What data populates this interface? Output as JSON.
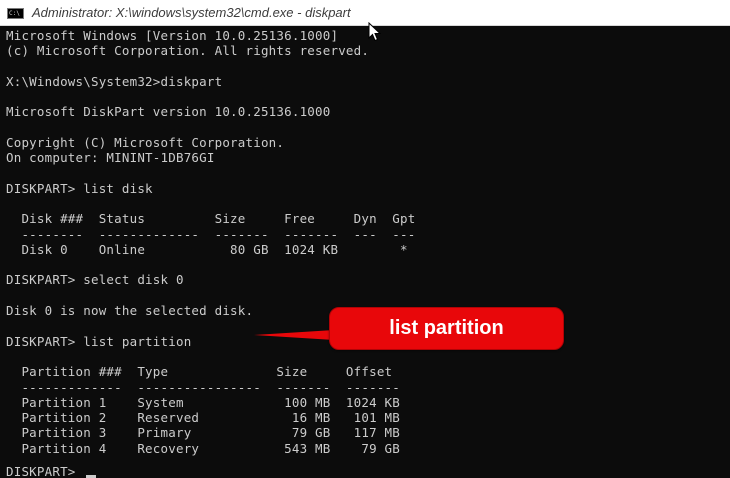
{
  "window": {
    "icon_text": "C:\\",
    "title": "Administrator: X:\\windows\\system32\\cmd.exe - diskpart"
  },
  "console": {
    "lines": [
      "Microsoft Windows [Version 10.0.25136.1000]",
      "(c) Microsoft Corporation. All rights reserved.",
      "",
      "X:\\Windows\\System32>diskpart",
      "",
      "Microsoft DiskPart version 10.0.25136.1000",
      "",
      "Copyright (C) Microsoft Corporation.",
      "On computer: MININT-1DB76GI",
      "",
      "DISKPART> list disk",
      "",
      "  Disk ###  Status         Size     Free     Dyn  Gpt",
      "  --------  -------------  -------  -------  ---  ---",
      "  Disk 0    Online           80 GB  1024 KB        *",
      "",
      "DISKPART> select disk 0",
      "",
      "Disk 0 is now the selected disk.",
      "",
      "DISKPART> list partition",
      "",
      "  Partition ###  Type              Size     Offset",
      "  -------------  ----------------  -------  -------",
      "  Partition 1    System             100 MB  1024 KB",
      "  Partition 2    Reserved            16 MB   101 MB",
      "  Partition 3    Primary             79 GB   117 MB",
      "  Partition 4    Recovery           543 MB    79 GB",
      "",
      "DISKPART> "
    ]
  },
  "annotation": {
    "label": "list partition",
    "color": "#e8070a"
  }
}
